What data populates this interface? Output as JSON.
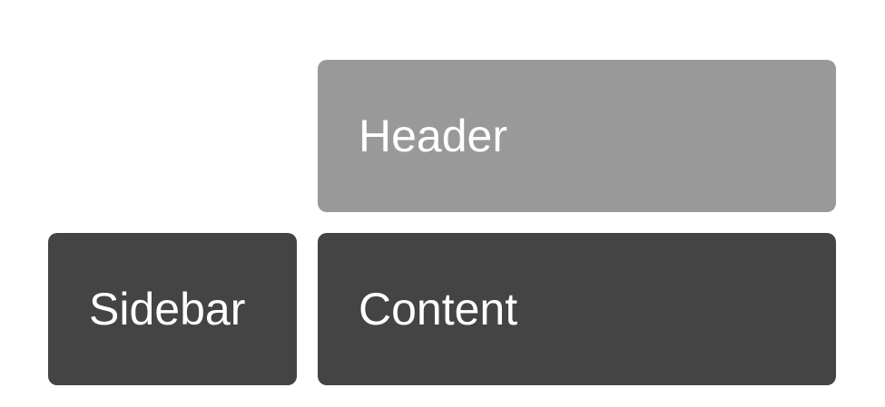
{
  "diagram": {
    "header": {
      "label": "Header",
      "color": "#999999"
    },
    "sidebar": {
      "label": "Sidebar",
      "color": "#444444"
    },
    "content": {
      "label": "Content",
      "color": "#444444"
    }
  }
}
